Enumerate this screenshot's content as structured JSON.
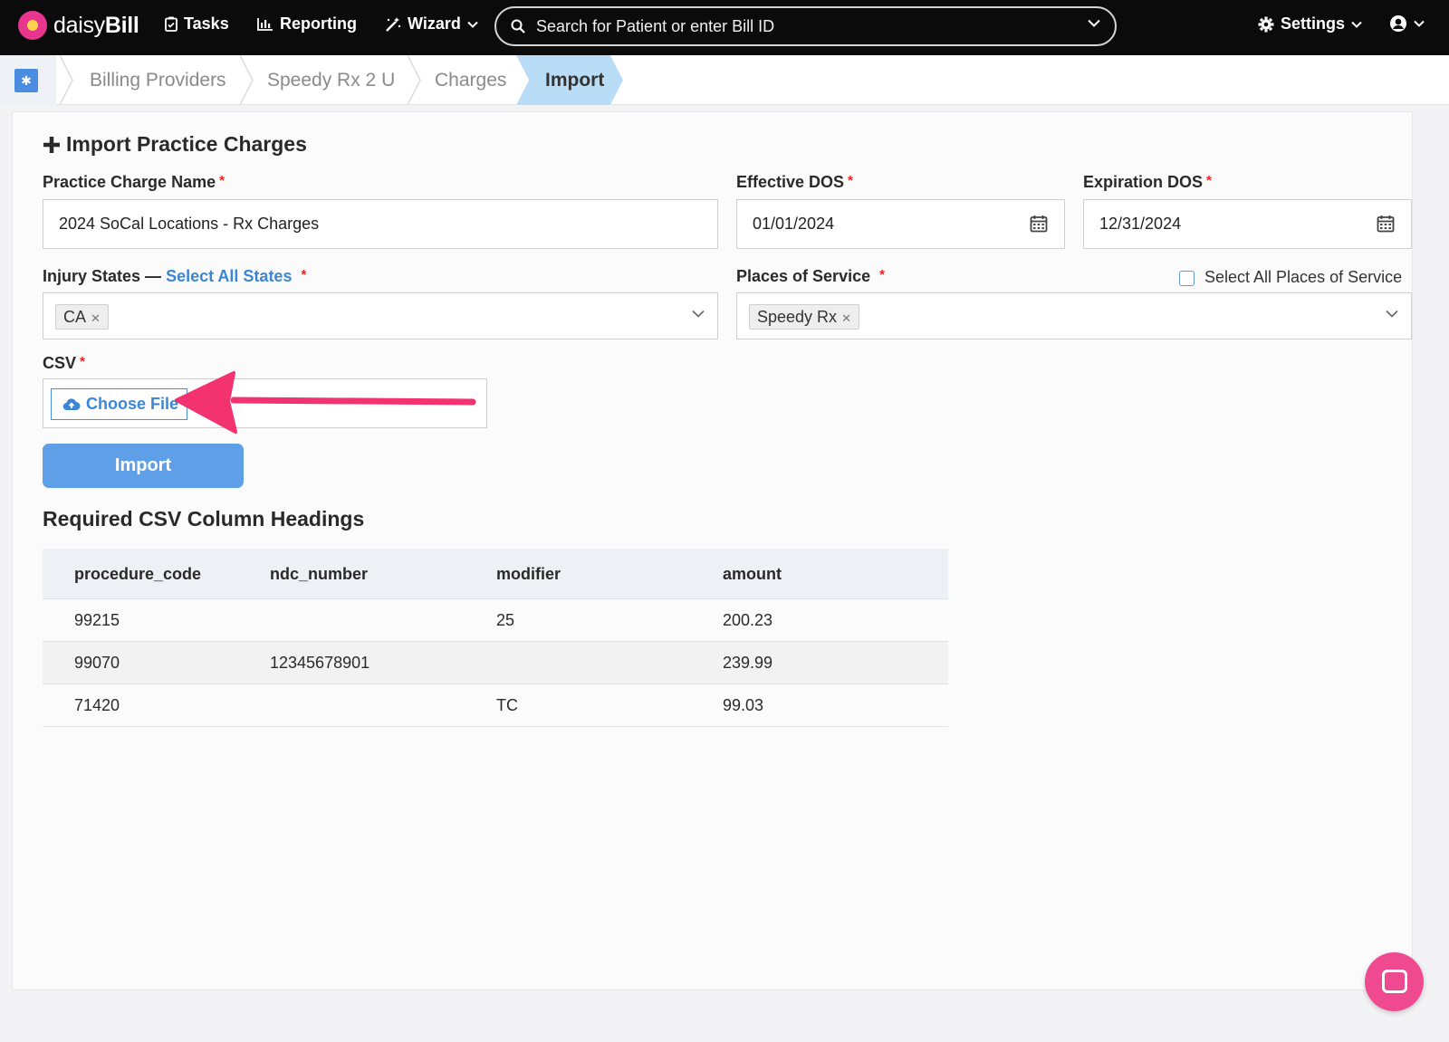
{
  "nav": {
    "brand_plain": "daisy",
    "brand_bold": "Bill",
    "tasks": "Tasks",
    "reporting": "Reporting",
    "wizard": "Wizard",
    "search_placeholder": "Search for Patient or enter Bill ID",
    "settings": "Settings"
  },
  "breadcrumb": {
    "items": [
      "Billing Providers",
      "Speedy Rx 2 U",
      "Charges",
      "Import"
    ]
  },
  "form": {
    "title": "Import Practice Charges",
    "charge_name_label": "Practice Charge Name",
    "charge_name_value": "2024 SoCal Locations - Rx Charges",
    "effective_label": "Effective DOS",
    "effective_value": "01/01/2024",
    "expiration_label": "Expiration DOS",
    "expiration_value": "12/31/2024",
    "injury_label": "Injury States —",
    "select_all_states": "Select All States",
    "injury_tags": [
      "CA"
    ],
    "places_label": "Places of Service",
    "select_all_places": "Select All Places of Service",
    "place_tags": [
      "Speedy Rx"
    ],
    "csv_label": "CSV",
    "choose_file": "Choose File",
    "import_button": "Import",
    "required_mark": "*"
  },
  "csv_table": {
    "title": "Required CSV Column Headings",
    "headers": [
      "procedure_code",
      "ndc_number",
      "modifier",
      "amount"
    ],
    "rows": [
      [
        "99215",
        "",
        "25",
        "200.23"
      ],
      [
        "99070",
        "12345678901",
        "",
        "239.99"
      ],
      [
        "71420",
        "",
        "TC",
        "99.03"
      ]
    ]
  },
  "colors": {
    "accent": "#3b86d6",
    "import_button": "#5e9fe8",
    "arrow": "#f2336f",
    "chat": "#ef4a90",
    "nav_bg": "#0b0b0b"
  }
}
